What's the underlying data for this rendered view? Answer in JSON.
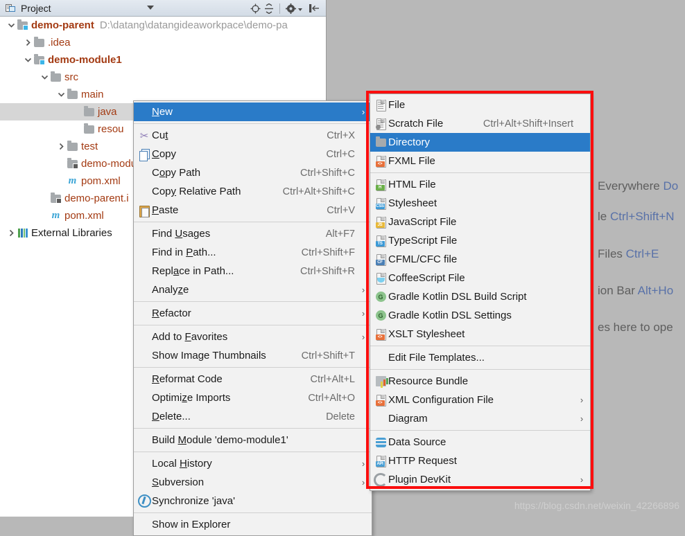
{
  "editor_background": {
    "hints": [
      {
        "text": "Everywhere ",
        "key": "Do"
      },
      {
        "text": "le ",
        "key": "Ctrl+Shift+N"
      },
      {
        "text": "Files ",
        "key": "Ctrl+E"
      },
      {
        "text": "ion Bar ",
        "key": "Alt+Ho"
      },
      {
        "text": "es here to ope",
        "key": ""
      }
    ],
    "watermark": "https://blog.csdn.net/weixin_42266896"
  },
  "project_panel": {
    "title": "Project",
    "title_icon": "project-window-icon",
    "dropdown_icon": "chevron-down-icon",
    "toolbar_icons": [
      {
        "name": "scroll-from-source-icon",
        "glyph": "⊕"
      },
      {
        "name": "collapse-all-icon",
        "glyph": "÷"
      },
      {
        "name": "settings-gear-icon",
        "glyph": "✱"
      },
      {
        "name": "hide-panel-icon",
        "glyph": "|←"
      }
    ],
    "tree": [
      {
        "indent": 0,
        "twisty": "v",
        "icon": "module-folder-icon",
        "label": "demo-parent",
        "bold": true,
        "path": "D:\\datang\\datangideaworkpace\\demo-pa"
      },
      {
        "indent": 1,
        "twisty": ">",
        "icon": "folder-icon",
        "label": ".idea",
        "bold": false,
        "path": ""
      },
      {
        "indent": 1,
        "twisty": "v",
        "icon": "module-folder-icon",
        "label": "demo-module1",
        "bold": true,
        "path": ""
      },
      {
        "indent": 2,
        "twisty": "v",
        "icon": "folder-icon",
        "label": "src",
        "bold": false,
        "path": ""
      },
      {
        "indent": 3,
        "twisty": "v",
        "icon": "folder-icon",
        "label": "main",
        "bold": false,
        "path": ""
      },
      {
        "indent": 4,
        "twisty": "",
        "icon": "folder-icon",
        "label": "java",
        "bold": false,
        "path": "",
        "selected": true
      },
      {
        "indent": 4,
        "twisty": "",
        "icon": "folder-icon",
        "label": "resou",
        "bold": false,
        "path": ""
      },
      {
        "indent": 3,
        "twisty": ">",
        "icon": "folder-icon",
        "label": "test",
        "bold": false,
        "path": ""
      },
      {
        "indent": 3,
        "twisty": "",
        "icon": "iml-file-icon",
        "label": "demo-modu",
        "bold": false,
        "path": ""
      },
      {
        "indent": 3,
        "twisty": "",
        "icon": "maven-pom-icon",
        "label": "pom.xml",
        "bold": false,
        "path": ""
      },
      {
        "indent": 2,
        "twisty": "",
        "icon": "iml-file-icon",
        "label": "demo-parent.i",
        "bold": false,
        "path": ""
      },
      {
        "indent": 2,
        "twisty": "",
        "icon": "maven-pom-icon",
        "label": "pom.xml",
        "bold": false,
        "path": ""
      },
      {
        "indent": 0,
        "twisty": ">",
        "icon": "libraries-icon",
        "label": "External Libraries",
        "bold": false,
        "plain": true,
        "path": ""
      }
    ]
  },
  "context_menu": {
    "items": [
      {
        "label": "New",
        "mnemonic": "N",
        "accel": "",
        "icon": "",
        "submenu": true,
        "highlighted": true
      },
      {
        "separator": true
      },
      {
        "label": "Cut",
        "mnemonic": "t",
        "accel": "Ctrl+X",
        "icon": "scissors-icon"
      },
      {
        "label": "Copy",
        "mnemonic": "C",
        "accel": "Ctrl+C",
        "icon": "copy-icon"
      },
      {
        "label": "Copy Path",
        "mnemonic": "o",
        "accel": "Ctrl+Shift+C",
        "icon": ""
      },
      {
        "label": "Copy Relative Path",
        "mnemonic": "y",
        "accel": "Ctrl+Alt+Shift+C",
        "icon": ""
      },
      {
        "label": "Paste",
        "mnemonic": "P",
        "accel": "Ctrl+V",
        "icon": "paste-icon"
      },
      {
        "separator": true
      },
      {
        "label": "Find Usages",
        "mnemonic": "U",
        "accel": "Alt+F7",
        "icon": ""
      },
      {
        "label": "Find in Path...",
        "mnemonic": "P",
        "accel": "Ctrl+Shift+F",
        "icon": ""
      },
      {
        "label": "Replace in Path...",
        "mnemonic": "a",
        "accel": "Ctrl+Shift+R",
        "icon": ""
      },
      {
        "label": "Analyze",
        "mnemonic": "z",
        "accel": "",
        "icon": "",
        "submenu": true
      },
      {
        "separator": true
      },
      {
        "label": "Refactor",
        "mnemonic": "R",
        "accel": "",
        "icon": "",
        "submenu": true
      },
      {
        "separator": true
      },
      {
        "label": "Add to Favorites",
        "mnemonic": "F",
        "accel": "",
        "icon": "",
        "submenu": true
      },
      {
        "label": "Show Image Thumbnails",
        "mnemonic": "",
        "accel": "Ctrl+Shift+T",
        "icon": ""
      },
      {
        "separator": true
      },
      {
        "label": "Reformat Code",
        "mnemonic": "R",
        "accel": "Ctrl+Alt+L",
        "icon": ""
      },
      {
        "label": "Optimize Imports",
        "mnemonic": "z",
        "accel": "Ctrl+Alt+O",
        "icon": ""
      },
      {
        "label": "Delete...",
        "mnemonic": "D",
        "accel": "Delete",
        "icon": ""
      },
      {
        "separator": true
      },
      {
        "label": "Build Module 'demo-module1'",
        "mnemonic": "M",
        "accel": "",
        "icon": ""
      },
      {
        "separator": true
      },
      {
        "label": "Local History",
        "mnemonic": "H",
        "accel": "",
        "icon": "",
        "submenu": true
      },
      {
        "label": "Subversion",
        "mnemonic": "S",
        "accel": "",
        "icon": "",
        "submenu": true
      },
      {
        "label": "Synchronize 'java'",
        "mnemonic": "",
        "accel": "",
        "icon": "sync-icon"
      },
      {
        "separator": true
      },
      {
        "label": "Show in Explorer",
        "mnemonic": "",
        "accel": "",
        "icon": ""
      }
    ]
  },
  "new_submenu": {
    "items": [
      {
        "label": "File",
        "accel": "",
        "icon": "file-icon"
      },
      {
        "label": "Scratch File",
        "accel": "Ctrl+Alt+Shift+Insert",
        "icon": "scratch-file-icon"
      },
      {
        "label": "Directory",
        "accel": "",
        "icon": "folder-icon",
        "highlighted": true
      },
      {
        "label": "FXML File",
        "accel": "",
        "icon": "fxml-file-icon",
        "badge": "<>",
        "badge_color": "#e8703a"
      },
      {
        "separator": true
      },
      {
        "label": "HTML File",
        "accel": "",
        "icon": "html-file-icon",
        "badge": "H",
        "badge_color": "#6cb04a"
      },
      {
        "label": "Stylesheet",
        "accel": "",
        "icon": "css-file-icon",
        "badge": "CSS",
        "badge_color": "#3d9ad6"
      },
      {
        "label": "JavaScript File",
        "accel": "",
        "icon": "js-file-icon",
        "badge": "JS",
        "badge_color": "#e8b93a"
      },
      {
        "label": "TypeScript File",
        "accel": "",
        "icon": "ts-file-icon",
        "badge": "TS",
        "badge_color": "#3d9ad6"
      },
      {
        "label": "CFML/CFC file",
        "accel": "",
        "icon": "cfml-file-icon",
        "badge": "CF",
        "badge_color": "#4a7fb5"
      },
      {
        "label": "CoffeeScript File",
        "accel": "",
        "icon": "coffeescript-file-icon"
      },
      {
        "label": "Gradle Kotlin DSL Build Script",
        "accel": "",
        "icon": "gradle-icon"
      },
      {
        "label": "Gradle Kotlin DSL Settings",
        "accel": "",
        "icon": "gradle-icon"
      },
      {
        "label": "XSLT Stylesheet",
        "accel": "",
        "icon": "xslt-file-icon",
        "badge": "<>",
        "badge_color": "#e8703a"
      },
      {
        "separator": true
      },
      {
        "label": "Edit File Templates...",
        "accel": "",
        "icon": ""
      },
      {
        "separator": true
      },
      {
        "label": "Resource Bundle",
        "accel": "",
        "icon": "resource-bundle-icon"
      },
      {
        "label": "XML Configuration File",
        "accel": "",
        "icon": "xml-file-icon",
        "badge": "<>",
        "badge_color": "#e8703a",
        "submenu": true
      },
      {
        "label": "Diagram",
        "accel": "",
        "icon": "",
        "submenu": true
      },
      {
        "separator": true
      },
      {
        "label": "Data Source",
        "accel": "",
        "icon": "data-source-icon"
      },
      {
        "label": "HTTP Request",
        "accel": "",
        "icon": "http-request-icon",
        "badge": "API",
        "badge_color": "#4a9fd4"
      },
      {
        "label": "Plugin DevKit",
        "accel": "",
        "icon": "plugin-devkit-icon",
        "submenu": true
      }
    ]
  },
  "annotation": {
    "highlight_color": "#fb0d0d",
    "selection_color": "#2a7bc8"
  }
}
